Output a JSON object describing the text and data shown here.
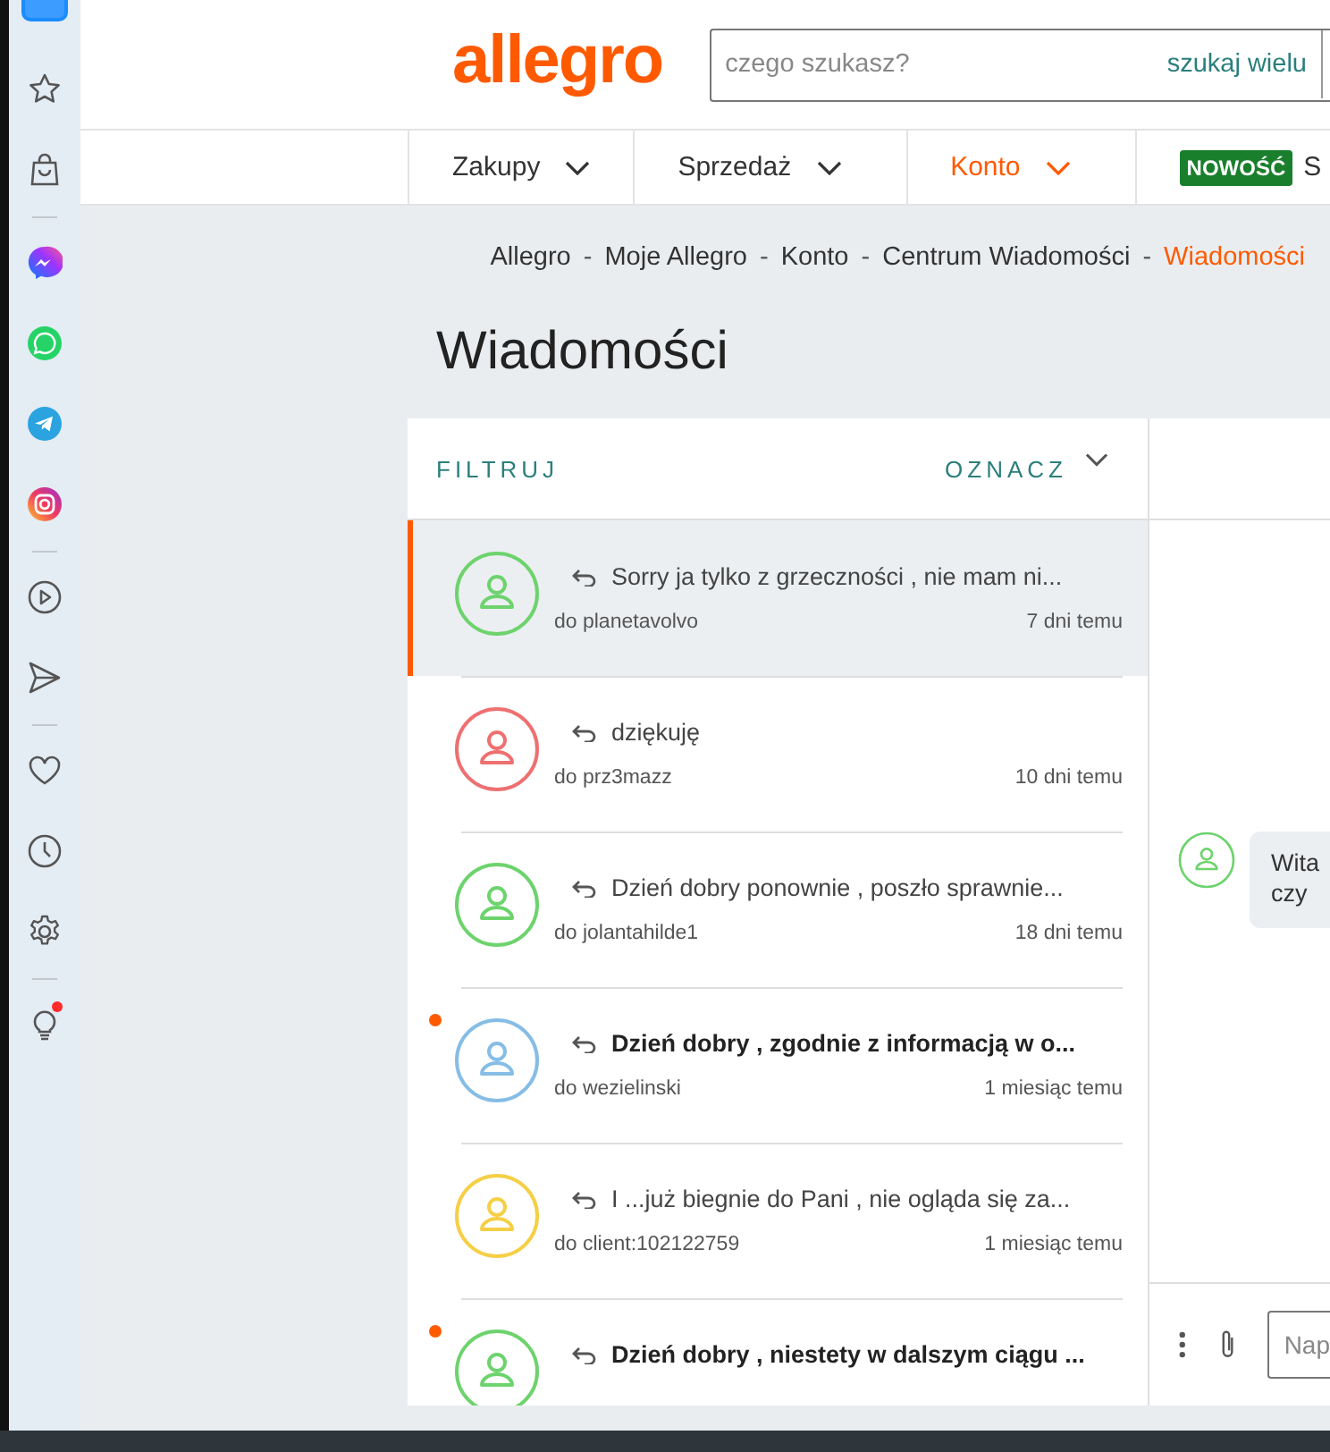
{
  "sidebar": {
    "tips_badge": true
  },
  "header": {
    "logo": "allegro",
    "search": {
      "placeholder": "czego szukasz?",
      "button": "szukaj wielu"
    }
  },
  "nav": [
    {
      "kind": "dropdown",
      "label": "Zakupy",
      "selected": false
    },
    {
      "kind": "dropdown",
      "label": "Sprzedaż",
      "selected": false
    },
    {
      "kind": "dropdown",
      "label": "Konto",
      "selected": true
    },
    {
      "kind": "badge",
      "badge": "NOWOŚĆ",
      "label": "S",
      "selected": false
    }
  ],
  "breadcrumb": [
    {
      "label": "Allegro",
      "selected": false
    },
    {
      "separator_before": "-",
      "label": "Moje Allegro",
      "selected": false
    },
    {
      "separator_before": "-",
      "label": "Konto",
      "selected": false
    },
    {
      "separator_before": "-",
      "label": "Centrum Wiadomości",
      "selected": false
    },
    {
      "separator_before": "-",
      "label": "Wiadomości",
      "selected": true
    }
  ],
  "page_title": "Wiadomości",
  "list_header": {
    "filter": "FILTRUJ",
    "mark": "OZNACZ"
  },
  "conversations": [
    {
      "color": "#6dd36d",
      "selected": true,
      "unread": false,
      "preview": "Sorry ja tylko z grzeczności , nie mam ni...",
      "recipient": "do planetavolvo",
      "time": "7 dni temu"
    },
    {
      "color": "#ee7070",
      "selected": false,
      "unread": false,
      "preview": "dziękuję",
      "recipient": "do prz3mazz",
      "time": "10 dni temu"
    },
    {
      "color": "#6dd36d",
      "selected": false,
      "unread": false,
      "preview": "Dzień dobry ponownie , poszło sprawnie...",
      "recipient": "do jolantahilde1",
      "time": "18 dni temu"
    },
    {
      "color": "#86bde6",
      "selected": false,
      "unread": true,
      "preview": "Dzień dobry , zgodnie z informacją w o...",
      "recipient": "do wezielinski",
      "time": "1 miesiąc temu"
    },
    {
      "color": "#f5cf45",
      "selected": false,
      "unread": false,
      "preview": "I ...już biegnie do Pani , nie ogląda się za...",
      "recipient": "do client:102122759",
      "time": "1 miesiąc temu"
    },
    {
      "color": "#6dd36d",
      "selected": false,
      "unread": true,
      "preview": "Dzień dobry , niestety w dalszym ciągu ..."
    }
  ],
  "chat": {
    "bubble_lines": [
      "Wita",
      "czy"
    ],
    "composer_placeholder": "Nap"
  }
}
